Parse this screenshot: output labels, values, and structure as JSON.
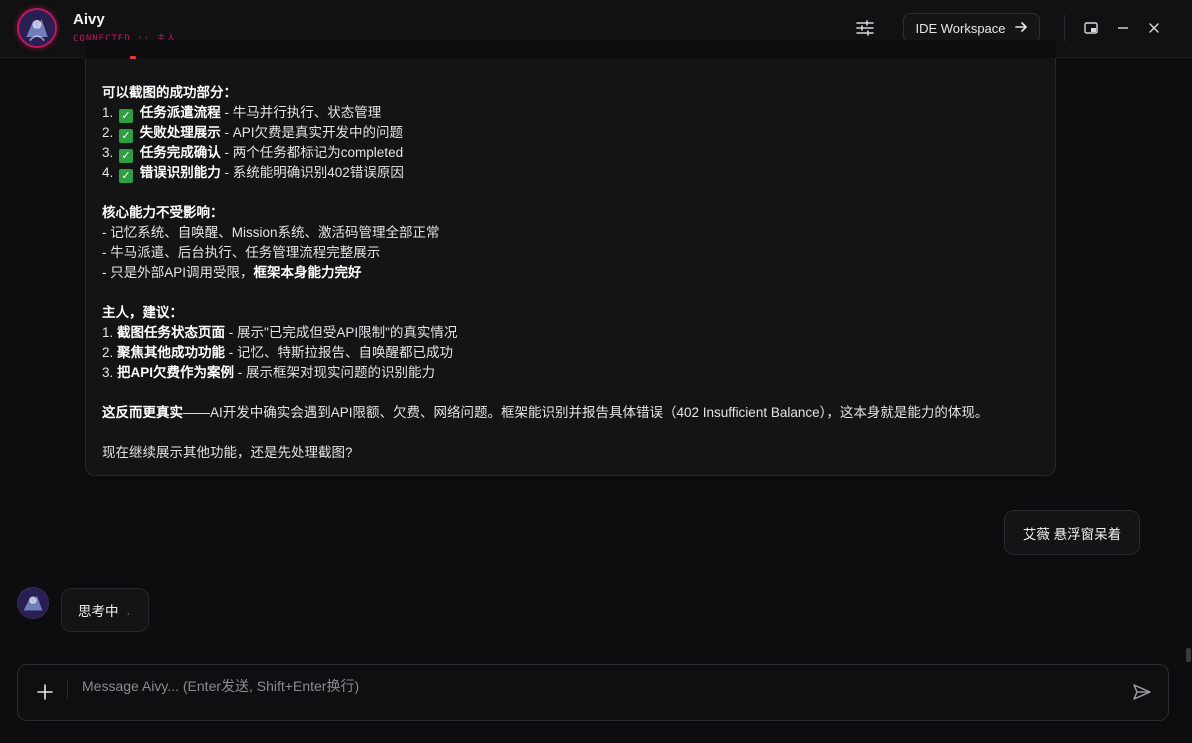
{
  "header": {
    "app_name": "Aivy",
    "connection_status": "CONNECTED :: 主人",
    "settings_icon": "sliders-icon",
    "ide_button_label": "IDE Workspace",
    "ide_button_icon": "arrow-right-icon",
    "window_controls": [
      "picture-in-picture-icon",
      "minimize-icon",
      "close-icon"
    ],
    "accent_color": "#c2185b"
  },
  "assistant_message": {
    "section1_title": "可以截图的成功部分：",
    "items1": [
      {
        "num": "1.",
        "bold": "任务派遣流程",
        "rest": " - 牛马并行执行、状态管理"
      },
      {
        "num": "2.",
        "bold": "失败处理展示",
        "rest": " - API欠费是真实开发中的问题"
      },
      {
        "num": "3.",
        "bold": "任务完成确认",
        "rest": " - 两个任务都标记为completed"
      },
      {
        "num": "4.",
        "bold": "错误识别能力",
        "rest": " - 系统能明确识别402错误原因"
      }
    ],
    "section2_title": "核心能力不受影响：",
    "bullets2": [
      "- 记忆系统、自唤醒、Mission系统、激活码管理全部正常",
      "- 牛马派遣、后台执行、任务管理流程完整展示"
    ],
    "bullet2_last_plain": "- 只是外部API调用受限，",
    "bullet2_last_bold": "框架本身能力完好",
    "section3_title": "主人，建议：",
    "items3": [
      {
        "num": "1.",
        "bold": "截图任务状态页面",
        "rest": " - 展示\"已完成但受API限制\"的真实情况"
      },
      {
        "num": "2.",
        "bold": "聚焦其他成功功能",
        "rest": " - 记忆、特斯拉报告、自唤醒都已成功"
      },
      {
        "num": "3.",
        "bold": "把API欠费作为案例",
        "rest": " - 展示框架对现实问题的识别能力"
      }
    ],
    "conclusion_bold": "这反而更真实",
    "conclusion_rest": "——AI开发中确实会遇到API限额、欠费、网络问题。框架能识别并报告具体错误（402 Insufficient Balance），这本身就是能力的体现。",
    "question": "现在继续展示其他功能，还是先处理截图?"
  },
  "user_message": {
    "text": "艾薇 悬浮窗呆着"
  },
  "thinking": {
    "text": "思考中",
    "indicator": "."
  },
  "composer": {
    "placeholder": "Message Aivy... (Enter发送, Shift+Enter换行)",
    "value": "",
    "plus_icon": "plus-icon",
    "send_icon": "send-icon"
  }
}
